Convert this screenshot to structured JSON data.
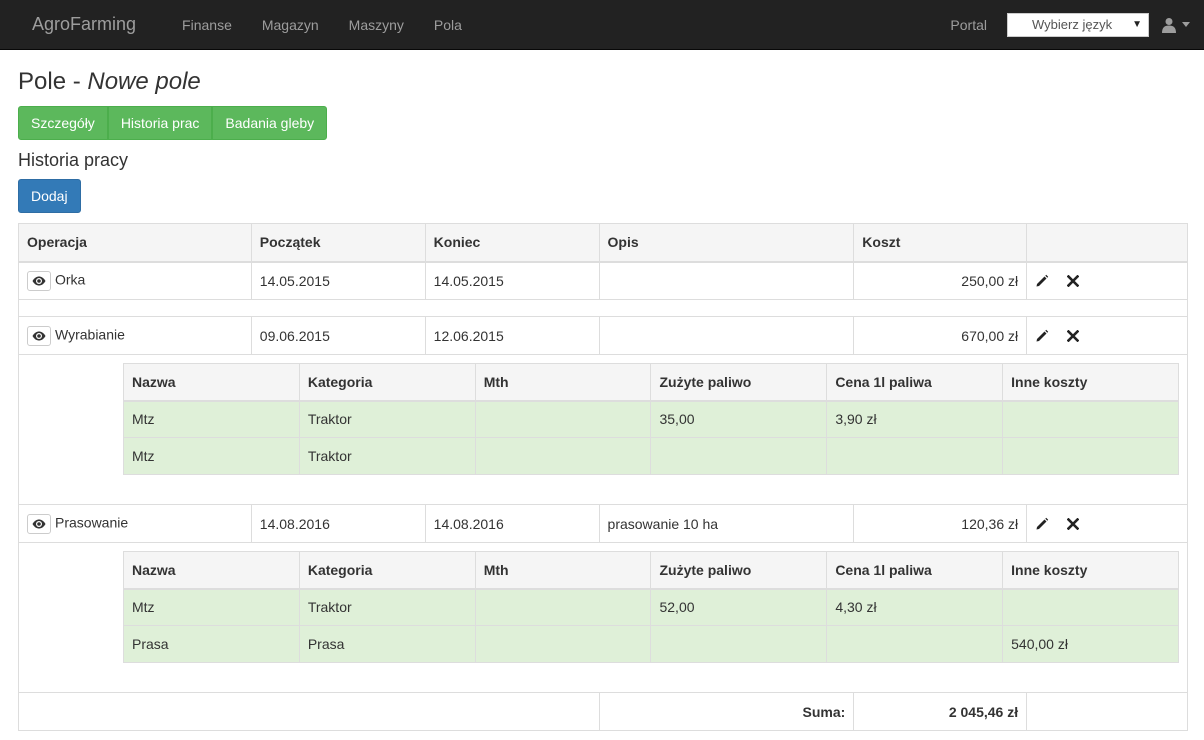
{
  "navbar": {
    "brand": "AgroFarming",
    "links": [
      "Finanse",
      "Magazyn",
      "Maszyny",
      "Pola"
    ],
    "portal": "Portal",
    "language_select": "Wybierz język",
    "icons": {
      "user": "user-icon",
      "caret": "caret-down-icon"
    }
  },
  "page": {
    "title": "Pole - ",
    "title_italic": "Nowe pole",
    "tabs": [
      "Szczegóły",
      "Historia prac",
      "Badania gleby"
    ],
    "section_title": "Historia pracy",
    "add_button": "Dodaj"
  },
  "table": {
    "headers": [
      "Operacja",
      "Początek",
      "Koniec",
      "Opis",
      "Koszt"
    ],
    "subheaders": [
      "Nazwa",
      "Kategoria",
      "Mth",
      "Zużyte paliwo",
      "Cena 1l paliwa",
      "Inne koszty"
    ],
    "rows": [
      {
        "operation": "Orka",
        "start": "14.05.2015",
        "end": "14.05.2015",
        "description": "",
        "cost": "250,00 zł"
      },
      {
        "operation": "Wyrabianie",
        "start": "09.06.2015",
        "end": "12.06.2015",
        "description": "",
        "cost": "670,00 zł",
        "items": [
          [
            "Mtz",
            "Traktor",
            "",
            "35,00",
            "3,90 zł",
            ""
          ],
          [
            "Mtz",
            "Traktor",
            "",
            "",
            "",
            ""
          ]
        ]
      },
      {
        "operation": "Prasowanie",
        "start": "14.08.2016",
        "end": "14.08.2016",
        "description": "prasowanie 10 ha",
        "cost": "120,36 zł",
        "items": [
          [
            "Mtz",
            "Traktor",
            "",
            "52,00",
            "4,30 zł",
            ""
          ],
          [
            "Prasa",
            "Prasa",
            "",
            "",
            "",
            "540,00 zł"
          ]
        ]
      }
    ],
    "sum_label": "Suma:",
    "sum_value": "2 045,46 zł"
  },
  "colors": {
    "navbar_bg": "#222222",
    "success": "#5cb85c",
    "primary": "#337ab7",
    "row_success": "#dff0d8"
  }
}
